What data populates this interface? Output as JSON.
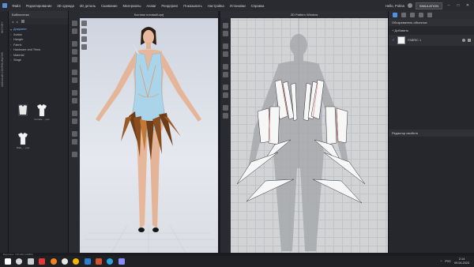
{
  "menu": {
    "items": [
      "Файл",
      "Редактирование",
      "3D одежда",
      "2D деталь",
      "Сшивание",
      "Материалы",
      "Avatar",
      "Рендеринг",
      "Показывать",
      "Настройка",
      "Установки",
      "Справка"
    ],
    "user": "Hello, Polina",
    "sim_label": "SIMULATION"
  },
  "left_strip": {
    "tabs": [
      "HISTORY",
      "MODULAR CONFIGURATOR"
    ]
  },
  "library": {
    "title": "Библиотека",
    "tree": [
      {
        "label": "Документ",
        "selected": true
      },
      {
        "label": "Avatar",
        "selected": false
      },
      {
        "label": "Hanger",
        "selected": false
      },
      {
        "label": "Fabric",
        "selected": false
      },
      {
        "label": "Hardware and Trims",
        "selected": false
      },
      {
        "label": "Material",
        "selected": false
      },
      {
        "label": "Stage",
        "selected": false
      }
    ],
    "thumbs": [
      {
        "caption": "",
        "color": "#4a4c52"
      },
      {
        "caption": "Female ... pos",
        "color": "#ffffff"
      },
      {
        "caption": "Male_... pos",
        "color": "#ffffff"
      }
    ]
  },
  "view3d": {
    "title": "Костюм готовый.zprj"
  },
  "view2d": {
    "title": "2D Pattern Window"
  },
  "object_browser": {
    "title": "Обозреватель объектов",
    "add_label": "+ Добавить",
    "fabric_name": "FABRIC 1"
  },
  "property_editor": {
    "title": "Редактор свойств"
  },
  "status": {
    "text": "Вершины: 735,338 (LIMBO)"
  },
  "taskbar": {
    "icons": [
      {
        "name": "start-icon",
        "color": "#ffffff"
      },
      {
        "name": "search-icon",
        "color": "#d9d9d9"
      },
      {
        "name": "task-view-icon",
        "color": "#cfcfcf"
      },
      {
        "name": "pdf-icon",
        "color": "#e53935"
      },
      {
        "name": "ok-icon",
        "color": "#f58220"
      },
      {
        "name": "yandex-icon",
        "color": "#e7e7e7"
      },
      {
        "name": "chrome-icon",
        "color": "#f2b705"
      },
      {
        "name": "word-icon",
        "color": "#2b7cd3"
      },
      {
        "name": "powerpoint-icon",
        "color": "#d35230"
      },
      {
        "name": "telegram-icon",
        "color": "#2aa3e0"
      },
      {
        "name": "clo-icon",
        "color": "#8a8cff"
      }
    ],
    "lang": "РУС",
    "time": "2:14",
    "date": "09.04.2023"
  },
  "colors": {
    "accent": "#4f93e6",
    "bodysuit": "#a9d4ea",
    "fringe": "#6e3d17",
    "skin": "#e6b79b"
  }
}
